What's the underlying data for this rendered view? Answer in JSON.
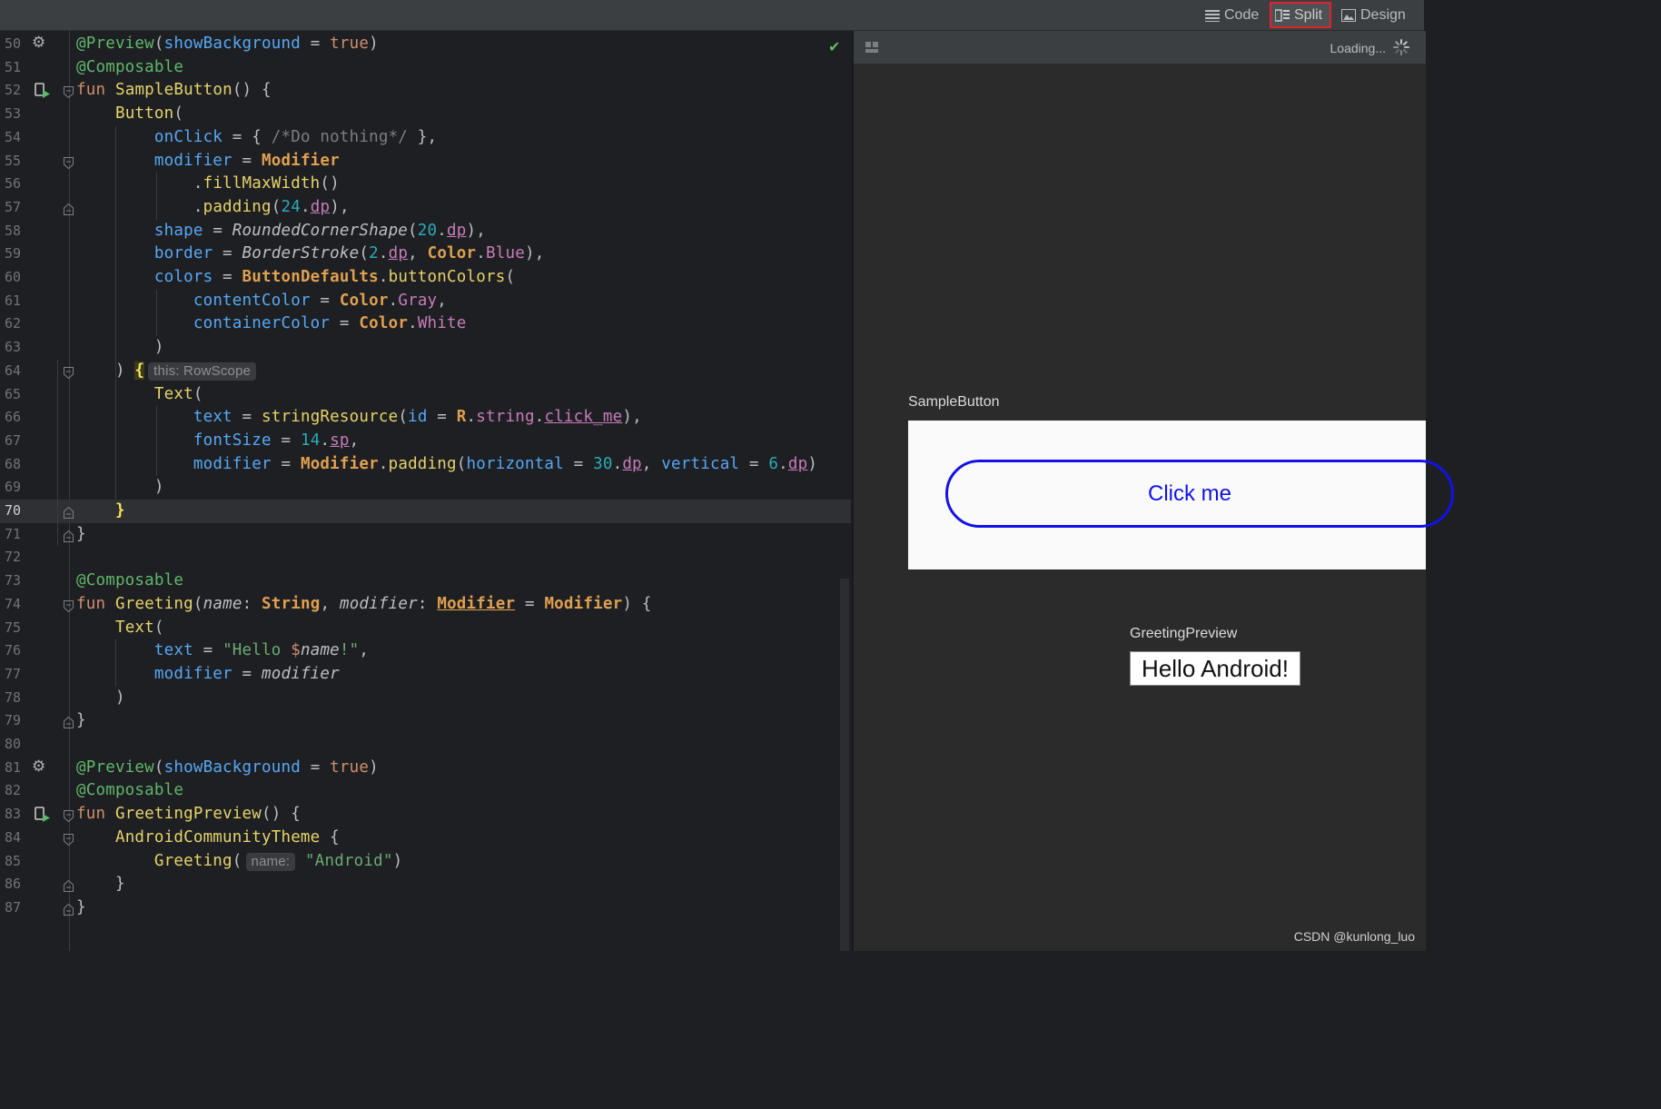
{
  "toolbar": {
    "code_label": "Code",
    "split_label": "Split",
    "design_label": "Design",
    "active_mode": "Split"
  },
  "editor": {
    "current_line": "70",
    "status_icon": "check-icon",
    "inlay_this": "this: RowScope",
    "inlay_name": "name:"
  },
  "preview": {
    "loading_text": "Loading...",
    "sample_button_title": "SampleButton",
    "click_me": "Click me",
    "greeting_preview_title": "GreetingPreview",
    "hello_android": "Hello Android!",
    "watermark": "CSDN @kunlong_luo"
  },
  "colors": {
    "button_border": "#1212e8",
    "split_highlight": "#e0222b"
  },
  "lines": [
    {
      "n": "50",
      "text": "@Preview(showBackground = true)"
    },
    {
      "n": "51",
      "text": "@Composable"
    },
    {
      "n": "52",
      "text": "fun SampleButton() {"
    },
    {
      "n": "53",
      "text": "    Button("
    },
    {
      "n": "54",
      "text": "        onClick = { /*Do nothing*/ },"
    },
    {
      "n": "55",
      "text": "        modifier = Modifier"
    },
    {
      "n": "56",
      "text": "            .fillMaxWidth()"
    },
    {
      "n": "57",
      "text": "            .padding(24.dp),"
    },
    {
      "n": "58",
      "text": "        shape = RoundedCornerShape(20.dp),"
    },
    {
      "n": "59",
      "text": "        border = BorderStroke(2.dp, Color.Blue),"
    },
    {
      "n": "60",
      "text": "        colors = ButtonDefaults.buttonColors("
    },
    {
      "n": "61",
      "text": "            contentColor = Color.Gray,"
    },
    {
      "n": "62",
      "text": "            containerColor = Color.White"
    },
    {
      "n": "63",
      "text": "        )"
    },
    {
      "n": "64",
      "text": "    ) {"
    },
    {
      "n": "65",
      "text": "        Text("
    },
    {
      "n": "66",
      "text": "            text = stringResource(id = R.string.click_me),"
    },
    {
      "n": "67",
      "text": "            fontSize = 14.sp,"
    },
    {
      "n": "68",
      "text": "            modifier = Modifier.padding(horizontal = 30.dp, vertical = 6.dp)"
    },
    {
      "n": "69",
      "text": "        )"
    },
    {
      "n": "70",
      "text": "    }"
    },
    {
      "n": "71",
      "text": "}"
    },
    {
      "n": "72",
      "text": ""
    },
    {
      "n": "73",
      "text": "@Composable"
    },
    {
      "n": "74",
      "text": "fun Greeting(name: String, modifier: Modifier = Modifier) {"
    },
    {
      "n": "75",
      "text": "    Text("
    },
    {
      "n": "76",
      "text": "        text = \"Hello $name!\","
    },
    {
      "n": "77",
      "text": "        modifier = modifier"
    },
    {
      "n": "78",
      "text": "    )"
    },
    {
      "n": "79",
      "text": "}"
    },
    {
      "n": "80",
      "text": ""
    },
    {
      "n": "81",
      "text": "@Preview(showBackground = true)"
    },
    {
      "n": "82",
      "text": "@Composable"
    },
    {
      "n": "83",
      "text": "fun GreetingPreview() {"
    },
    {
      "n": "84",
      "text": "    AndroidCommunityTheme {"
    },
    {
      "n": "85",
      "text": "        Greeting(\"Android\")"
    },
    {
      "n": "86",
      "text": "    }"
    },
    {
      "n": "87",
      "text": "}"
    }
  ]
}
